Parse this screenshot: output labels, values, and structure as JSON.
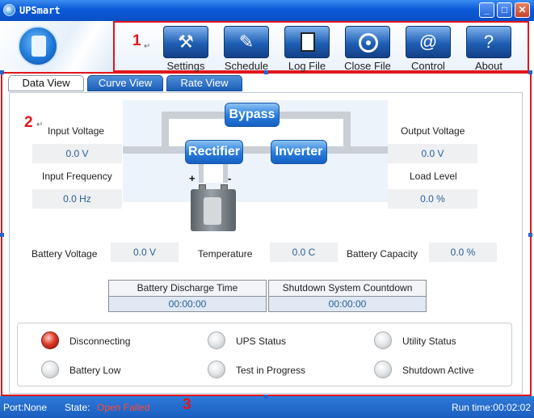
{
  "window": {
    "title": "UPSmart",
    "minimize": "_",
    "maximize": "□",
    "close": "✕"
  },
  "toolbar": {
    "items": [
      {
        "label": "Settings",
        "icon": "hammer-icon"
      },
      {
        "label": "Schedule",
        "icon": "pen-tablet-icon"
      },
      {
        "label": "Log File",
        "icon": "document-icon"
      },
      {
        "label": "Close File",
        "icon": "disc-icon"
      },
      {
        "label": "Control",
        "icon": "at-icon"
      },
      {
        "label": "About",
        "icon": "question-icon"
      }
    ],
    "control_symbol": "@",
    "about_symbol": "?",
    "settings_symbol": "⚒",
    "schedule_symbol": "✎"
  },
  "annotations": {
    "a1": "1",
    "a2": "2",
    "a3": "3",
    "arrow": "↵"
  },
  "tabs": [
    {
      "label": "Data View",
      "active": true
    },
    {
      "label": "Curve View",
      "active": false
    },
    {
      "label": "Rate View",
      "active": false
    }
  ],
  "diagram": {
    "bypass": "Bypass",
    "rectifier": "Rectifier",
    "inverter": "Inverter",
    "plus": "+",
    "minus": "-"
  },
  "readings": {
    "input_voltage_label": "Input Voltage",
    "input_voltage": "0.0 V",
    "input_frequency_label": "Input Frequency",
    "input_frequency": "0.0 Hz",
    "output_voltage_label": "Output Voltage",
    "output_voltage": "0.0 V",
    "load_level_label": "Load Level",
    "load_level": "0.0 %",
    "battery_voltage_label": "Battery Voltage",
    "battery_voltage": "0.0 V",
    "temperature_label": "Temperature",
    "temperature": "0.0 C",
    "battery_capacity_label": "Battery Capacity",
    "battery_capacity": "0.0 %"
  },
  "timers": {
    "discharge_label": "Battery Discharge Time",
    "discharge": "00:00:00",
    "shutdown_label": "Shutdown System Countdown",
    "shutdown": "00:00:00"
  },
  "indicators": [
    {
      "label": "Disconnecting",
      "on": true,
      "color": "#e03c2c"
    },
    {
      "label": "UPS Status",
      "on": false
    },
    {
      "label": "Utility Status",
      "on": false
    },
    {
      "label": "Battery Low",
      "on": false
    },
    {
      "label": "Test in Progress",
      "on": false
    },
    {
      "label": "Shutdown Active",
      "on": false
    }
  ],
  "statusbar": {
    "port": "Port:None",
    "state_label": "State:",
    "state_value": "Open Failed",
    "runtime": "Run time:00:02:02"
  },
  "colors": {
    "accent": "#1a5ec0",
    "highlight": "#e0161c",
    "value_text": "#2a5f97"
  }
}
